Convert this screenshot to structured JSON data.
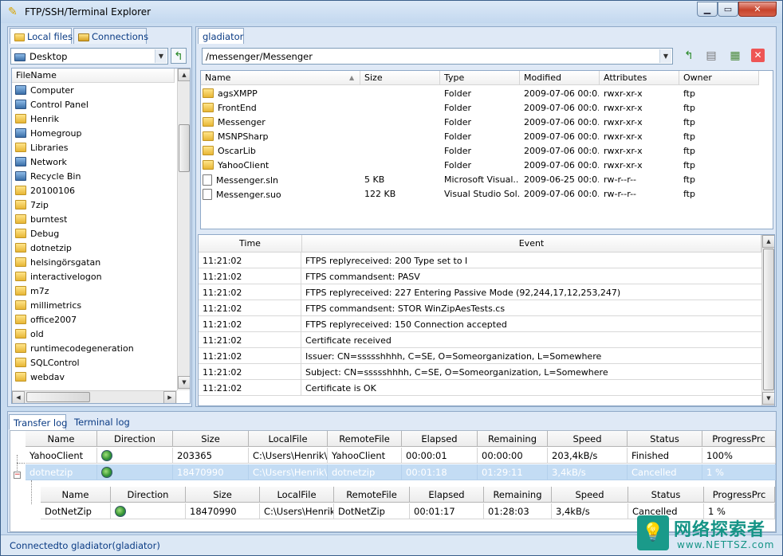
{
  "window": {
    "title": "FTP/SSH/Terminal Explorer"
  },
  "left": {
    "tabs": [
      {
        "label": "Local files"
      },
      {
        "label": "Connections"
      }
    ],
    "location": "Desktop",
    "column": "FileName",
    "items": [
      {
        "name": "Computer",
        "icon": "computer-icon"
      },
      {
        "name": "Control Panel",
        "icon": "control-panel-icon"
      },
      {
        "name": "Henrik",
        "icon": "user-folder-icon"
      },
      {
        "name": "Homegroup",
        "icon": "homegroup-icon"
      },
      {
        "name": "Libraries",
        "icon": "libraries-icon"
      },
      {
        "name": "Network",
        "icon": "network-icon"
      },
      {
        "name": "Recycle Bin",
        "icon": "recycle-bin-icon"
      },
      {
        "name": "20100106",
        "icon": "folder-icon"
      },
      {
        "name": "7zip",
        "icon": "folder-icon"
      },
      {
        "name": "burntest",
        "icon": "folder-icon"
      },
      {
        "name": "Debug",
        "icon": "folder-icon"
      },
      {
        "name": "dotnetzip",
        "icon": "folder-icon"
      },
      {
        "name": "helsingörsgatan",
        "icon": "folder-icon"
      },
      {
        "name": "interactivelogon",
        "icon": "folder-icon"
      },
      {
        "name": "m7z",
        "icon": "folder-icon"
      },
      {
        "name": "millimetrics",
        "icon": "folder-icon"
      },
      {
        "name": "office2007",
        "icon": "folder-icon"
      },
      {
        "name": "old",
        "icon": "folder-icon"
      },
      {
        "name": "runtimecodegeneration",
        "icon": "folder-icon"
      },
      {
        "name": "SQLControl",
        "icon": "folder-icon"
      },
      {
        "name": "webdav",
        "icon": "folder-icon"
      }
    ]
  },
  "right": {
    "tab": "gladiator",
    "path": "/messenger/Messenger",
    "columns": [
      "Name",
      "Size",
      "Type",
      "Modified",
      "Attributes",
      "Owner"
    ],
    "files": [
      {
        "name": "agsXMPP",
        "size": "",
        "type": "Folder",
        "modified": "2009-07-06  00:0...",
        "attr": "rwxr-xr-x",
        "owner": "ftp",
        "icon": "folder-icon"
      },
      {
        "name": "FrontEnd",
        "size": "",
        "type": "Folder",
        "modified": "2009-07-06  00:0...",
        "attr": "rwxr-xr-x",
        "owner": "ftp",
        "icon": "folder-icon"
      },
      {
        "name": "Messenger",
        "size": "",
        "type": "Folder",
        "modified": "2009-07-06  00:0...",
        "attr": "rwxr-xr-x",
        "owner": "ftp",
        "icon": "folder-icon"
      },
      {
        "name": "MSNPSharp",
        "size": "",
        "type": "Folder",
        "modified": "2009-07-06  00:0...",
        "attr": "rwxr-xr-x",
        "owner": "ftp",
        "icon": "folder-icon"
      },
      {
        "name": "OscarLib",
        "size": "",
        "type": "Folder",
        "modified": "2009-07-06  00:0...",
        "attr": "rwxr-xr-x",
        "owner": "ftp",
        "icon": "folder-icon"
      },
      {
        "name": "YahooClient",
        "size": "",
        "type": "Folder",
        "modified": "2009-07-06  00:0...",
        "attr": "rwxr-xr-x",
        "owner": "ftp",
        "icon": "folder-icon"
      },
      {
        "name": "Messenger.sln",
        "size": "5 KB",
        "type": "Microsoft Visual...",
        "modified": "2009-06-25  00:0...",
        "attr": "rw-r--r--",
        "owner": "ftp",
        "icon": "solution-file-icon"
      },
      {
        "name": "Messenger.suo",
        "size": "122 KB",
        "type": "Visual Studio Sol...",
        "modified": "2009-07-06  00:0...",
        "attr": "rw-r--r--",
        "owner": "ftp",
        "icon": "solution-options-file-icon"
      }
    ],
    "log_columns": [
      "Time",
      "Event"
    ],
    "log": [
      {
        "time": "11:21:02",
        "event": "FTPS replyreceived: 200 Type set to I"
      },
      {
        "time": "11:21:02",
        "event": "FTPS commandsent: PASV"
      },
      {
        "time": "11:21:02",
        "event": "FTPS replyreceived: 227 Entering Passive Mode (92,244,17,12,253,247)"
      },
      {
        "time": "11:21:02",
        "event": "FTPS commandsent: STOR WinZipAesTests.cs"
      },
      {
        "time": "11:21:02",
        "event": "FTPS replyreceived: 150 Connection accepted"
      },
      {
        "time": "11:21:02",
        "event": "Certificate received"
      },
      {
        "time": "11:21:02",
        "event": "Issuer: CN=ssssshhhh, C=SE, O=Someorganization, L=Somewhere"
      },
      {
        "time": "11:21:02",
        "event": "Subject: CN=ssssshhhh, C=SE, O=Someorganization, L=Somewhere"
      },
      {
        "time": "11:21:02",
        "event": "Certificate is OK"
      }
    ]
  },
  "bottom": {
    "tabs": [
      {
        "label": "Transfer log"
      },
      {
        "label": "Terminal log"
      }
    ],
    "columns": [
      "Name",
      "Direction",
      "Size",
      "LocalFile",
      "RemoteFile",
      "Elapsed",
      "Remaining",
      "Speed",
      "Status",
      "ProgressPrc"
    ],
    "transfers": [
      {
        "name": "YahooClient",
        "size": "203365",
        "local": "C:\\Users\\Henrik\\",
        "remote": "YahooClient",
        "elapsed": "00:00:01",
        "remaining": "00:00:00",
        "speed": "203,4kB/s",
        "status": "Finished",
        "progress": "100%"
      },
      {
        "name": "dotnetzip",
        "size": "18470990",
        "local": "C:\\Users\\Henrik\\",
        "remote": "dotnetzip",
        "elapsed": "00:01:18",
        "remaining": "01:29:11",
        "speed": "3,4kB/s",
        "status": "Cancelled",
        "progress": "1 %"
      }
    ],
    "child": {
      "name": "DotNetZip",
      "size": "18470990",
      "local": "C:\\Users\\Henrik\\",
      "remote": "DotNetZip",
      "elapsed": "00:01:17",
      "remaining": "01:28:03",
      "speed": "3,4kB/s",
      "status": "Cancelled",
      "progress": "1 %"
    }
  },
  "status": "Connectedto gladiator(gladiator)",
  "watermark": {
    "cn": "网络探索者",
    "url": "www.NETTSZ.com"
  }
}
